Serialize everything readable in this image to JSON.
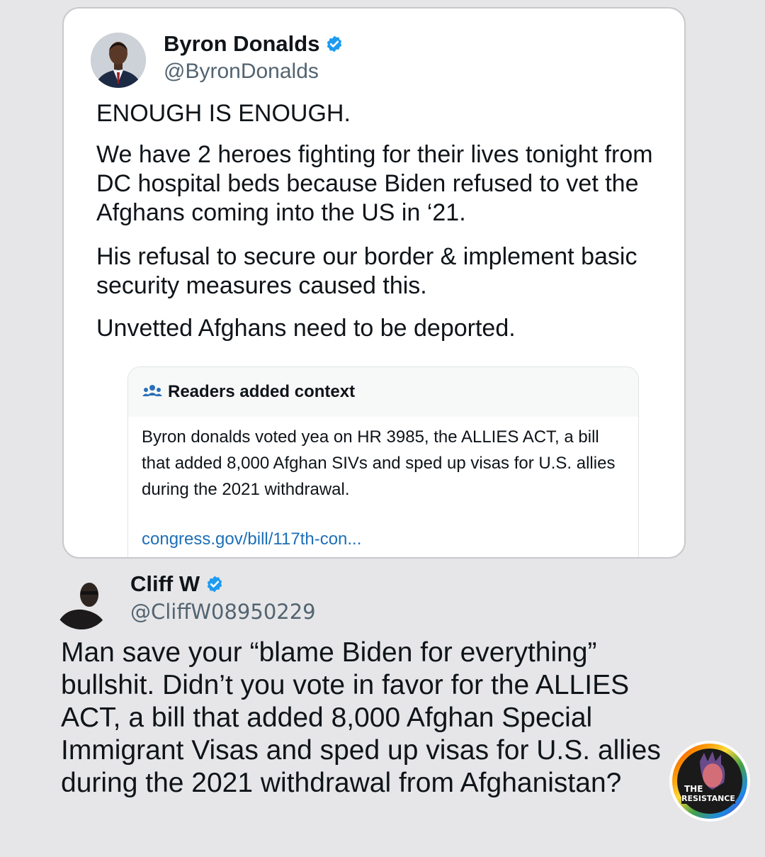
{
  "tweet": {
    "author_name": "Byron Donalds",
    "author_handle": "@ByronDonalds",
    "paragraphs": [
      "ENOUGH IS ENOUGH.",
      "We have 2 heroes fighting for their lives tonight from DC hospital beds because Biden refused to vet the Afghans coming into the US in ‘21.",
      "His refusal to secure our border & implement basic security measures caused this.",
      "Unvetted Afghans need to be deported."
    ],
    "community_note": {
      "header": "Readers added context",
      "icon": "people-icon",
      "text": "Byron donalds voted yea on HR 3985, the ALLIES ACT, a bill that added 8,000 Afghan SIVs and sped up visas for U.S. allies during the 2021 withdrawal.",
      "link": "congress.gov/bill/117th-con..."
    }
  },
  "reply": {
    "author_name": "Cliff W",
    "author_handle": "@CliffW08950229",
    "text": "Man save your “blame Biden for everything” bullshit. Didn’t you vote in favor for the ALLIES ACT, a bill that added 8,000 Afghan Special Immigrant Visas and sped up visas for U.S. allies during the 2021 withdrawal from Afghanistan?"
  },
  "watermark": {
    "line1": "THE",
    "line2": "RESISTANCE"
  },
  "colors": {
    "verified": "#1d9bf0",
    "link": "#1d6fb8",
    "background": "#e6e6e8"
  }
}
